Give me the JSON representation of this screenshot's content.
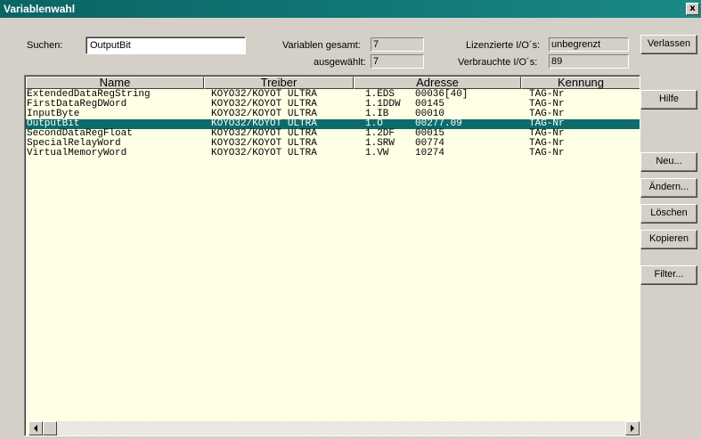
{
  "window": {
    "title": "Variablenwahl",
    "close_glyph": "x"
  },
  "search": {
    "label": "Suchen:",
    "value": "OutputBit"
  },
  "stats": {
    "total_label": "Variablen gesamt:",
    "total_value": "7",
    "selected_label": "ausgewählt:",
    "selected_value": "7",
    "licensed_label": "Lizenzierte I/O´s:",
    "licensed_value": "unbegrenzt",
    "used_label": "Verbrauchte I/O´s:",
    "used_value": "89"
  },
  "buttons": {
    "exit": "Verlassen",
    "help": "Hilfe",
    "new": "Neu...",
    "edit": "Ändern...",
    "delete": "Löschen",
    "copy": "Kopieren",
    "filter": "Filter..."
  },
  "table": {
    "columns": [
      "Name",
      "Treiber",
      "Adresse",
      "Kennung"
    ],
    "rows": [
      {
        "name": "ExtendedDataRegString",
        "driver": "KOYO32/KOYOT ULTRA",
        "addr1": "1.EDS",
        "addr2": "00036[40]",
        "id": "TAG-Nr",
        "selected": false
      },
      {
        "name": "FirstDataRegDWord",
        "driver": "KOYO32/KOYOT ULTRA",
        "addr1": "1.1DDW",
        "addr2": "00145",
        "id": "TAG-Nr",
        "selected": false
      },
      {
        "name": "InputByte",
        "driver": "KOYO32/KOYOT ULTRA",
        "addr1": "1.IB",
        "addr2": "00010",
        "id": "TAG-Nr",
        "selected": false
      },
      {
        "name": "OutputBit",
        "driver": "KOYO32/KOYOT ULTRA",
        "addr1": "1.O",
        "addr2": "00277.09",
        "id": "TAG-Nr",
        "selected": true
      },
      {
        "name": "SecondDataRegFloat",
        "driver": "KOYO32/KOYOT ULTRA",
        "addr1": "1.2DF",
        "addr2": "00015",
        "id": "TAG-Nr",
        "selected": false
      },
      {
        "name": "SpecialRelayWord",
        "driver": "KOYO32/KOYOT ULTRA",
        "addr1": "1.SRW",
        "addr2": "00774",
        "id": "TAG-Nr",
        "selected": false
      },
      {
        "name": "VirtualMemoryWord",
        "driver": "KOYO32/KOYOT ULTRA",
        "addr1": "1.VW",
        "addr2": "10274",
        "id": "TAG-Nr",
        "selected": false
      }
    ]
  },
  "colors": {
    "titlebar": "#0d6b6b",
    "selection": "#0d6b6b",
    "list_bg": "#ffffe6",
    "dialog_bg": "#d4d0c8"
  },
  "icons": {
    "close": "close-icon",
    "scroll_left": "arrow-left-icon",
    "scroll_right": "arrow-right-icon"
  }
}
